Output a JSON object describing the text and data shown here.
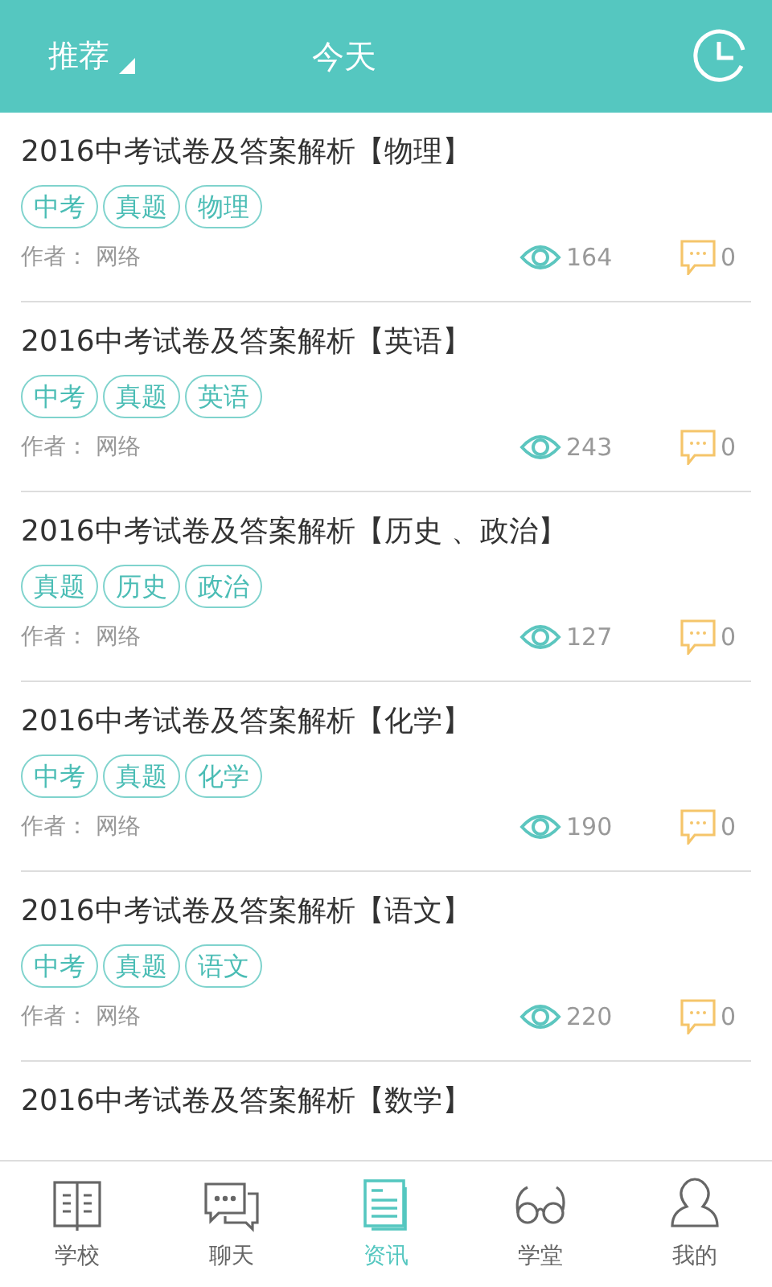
{
  "header": {
    "filter": "推荐",
    "title": "今天"
  },
  "articles": [
    {
      "title": "2016中考试卷及答案解析【物理】",
      "tags": [
        "中考",
        "真题",
        "物理"
      ],
      "author": "作者：  网络",
      "views": "164",
      "comments": "0"
    },
    {
      "title": "2016中考试卷及答案解析【英语】",
      "tags": [
        "中考",
        "真题",
        "英语"
      ],
      "author": "作者：  网络",
      "views": "243",
      "comments": "0"
    },
    {
      "title": "2016中考试卷及答案解析【历史 、政治】",
      "tags": [
        "真题",
        "历史",
        "政治"
      ],
      "author": "作者：  网络",
      "views": "127",
      "comments": "0"
    },
    {
      "title": "2016中考试卷及答案解析【化学】",
      "tags": [
        "中考",
        "真题",
        "化学"
      ],
      "author": "作者：  网络",
      "views": "190",
      "comments": "0"
    },
    {
      "title": "2016中考试卷及答案解析【语文】",
      "tags": [
        "中考",
        "真题",
        "语文"
      ],
      "author": "作者：  网络",
      "views": "220",
      "comments": "0"
    },
    {
      "title": "2016中考试卷及答案解析【数学】"
    }
  ],
  "nav": [
    {
      "kind": "school",
      "label": "学校",
      "selected": false
    },
    {
      "kind": "chat",
      "label": "聊天",
      "selected": false
    },
    {
      "kind": "news",
      "label": "资讯",
      "selected": true
    },
    {
      "kind": "study",
      "label": "学堂",
      "selected": false
    },
    {
      "kind": "profile",
      "label": "我的",
      "selected": false
    }
  ]
}
